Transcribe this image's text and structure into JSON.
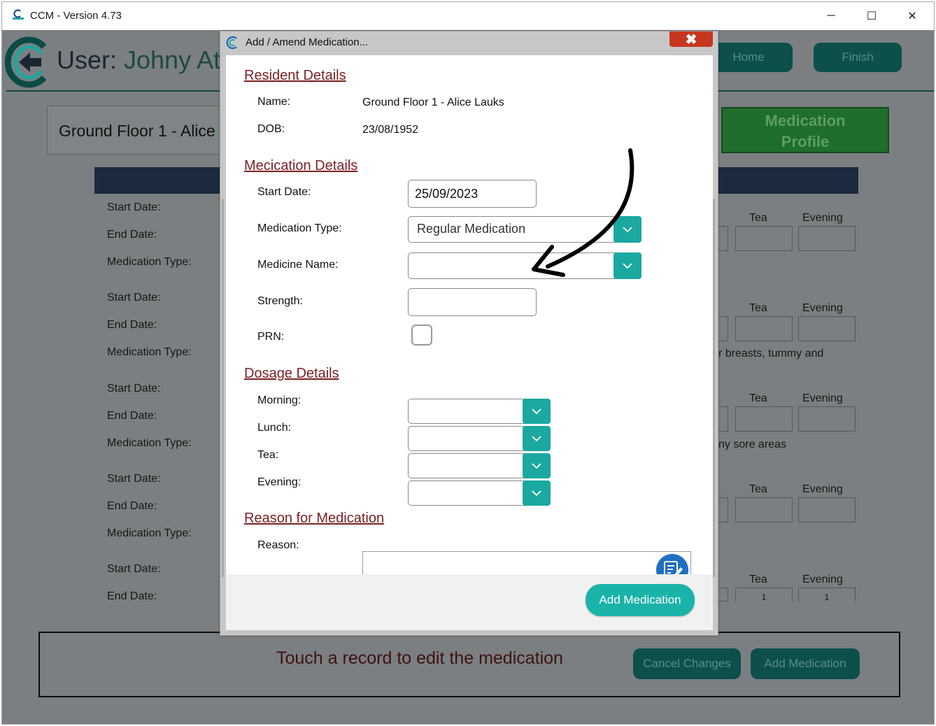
{
  "window": {
    "title": "CCM - Version 4.73",
    "minimize": "─",
    "maximize": "☐",
    "close": "✕"
  },
  "app": {
    "user_prefix": "User: ",
    "user_name": "Johny At",
    "nav": {
      "home": "Home",
      "finish": "Finish"
    },
    "resident_title": "Ground Floor 1 - Alice",
    "profile_line1": "Medication",
    "profile_line2": "Profile",
    "row_labels": {
      "start": "Start Date:",
      "end": "End Date:",
      "type": "Medication Type:"
    },
    "col_heads": {
      "tea": "Tea",
      "evening": "Evening"
    },
    "notes": {
      "n1": "r breasts, tummy and",
      "n2": "ny sore areas"
    },
    "cell_values": {
      "one": "1"
    },
    "bottom": {
      "touch_text": "Touch a record to edit the medication",
      "cancel": "Cancel Changes",
      "add": "Add Medication"
    }
  },
  "dialog": {
    "title": "Add / Amend Medication...",
    "close": "✖",
    "resident": {
      "heading": "Resident Details",
      "name_label": "Name:",
      "name_value": "Ground Floor 1 - Alice Lauks",
      "dob_label": "DOB:",
      "dob_value": "23/08/1952"
    },
    "medication": {
      "heading": "Mecication Details",
      "start_label": "Start Date:",
      "start_value": "25/09/2023",
      "type_label": "Medication Type:",
      "type_value": "Regular Medication",
      "name_label": "Medicine Name:",
      "name_value": "",
      "strength_label": "Strength:",
      "strength_value": "",
      "prn_label": "PRN:"
    },
    "dosage": {
      "heading": "Dosage Details",
      "morning_label": "Morning:",
      "lunch_label": "Lunch:",
      "tea_label": "Tea:",
      "evening_label": "Evening:"
    },
    "reason": {
      "heading": "Reason for Medication",
      "label": "Reason:"
    },
    "add_button": "Add Medication"
  },
  "colors": {
    "accent_teal": "#1ab3aa",
    "heading_red": "#7b2123",
    "close_red": "#c7361f",
    "profile_green": "#1f6e2b"
  },
  "icons": [
    "app-logo-icon",
    "dialog-app-icon",
    "chevron-down-icon",
    "notes-edit-icon",
    "curved-arrow-annotation"
  ]
}
